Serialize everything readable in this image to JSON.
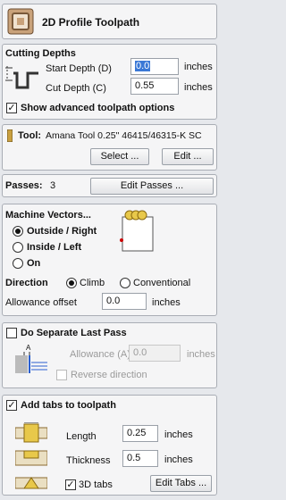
{
  "header": {
    "title": "2D Profile Toolpath",
    "icon": "profile-toolpath-icon"
  },
  "cutting_depths": {
    "title": "Cutting Depths",
    "start_label": "Start Depth (D)",
    "start_value": "0.0",
    "start_unit": "inches",
    "cut_label": "Cut Depth (C)",
    "cut_value": "0.55",
    "cut_unit": "inches",
    "advanced_label": "Show advanced toolpath options",
    "advanced_checked": true
  },
  "tool": {
    "label": "Tool:",
    "name": "Amana Tool 0.25\" 46415/46315-K SC",
    "select_label": "Select ...",
    "edit_label": "Edit ..."
  },
  "passes": {
    "label": "Passes:",
    "value": "3",
    "edit_label": "Edit Passes ..."
  },
  "machine_vectors": {
    "title": "Machine Vectors...",
    "options": [
      "Outside / Right",
      "Inside / Left",
      "On"
    ],
    "selected": "Outside / Right",
    "direction_label": "Direction",
    "direction_options": [
      "Climb",
      "Conventional"
    ],
    "direction_selected": "Climb",
    "allowance_label": "Allowance offset",
    "allowance_value": "0.0",
    "allowance_unit": "inches"
  },
  "separate_last_pass": {
    "title": "Do Separate Last Pass",
    "checked": false,
    "allowance_label": "Allowance (A)",
    "allowance_value": "0.0",
    "allowance_unit": "inches",
    "reverse_label": "Reverse direction",
    "diagram_letter": "A"
  },
  "tabs": {
    "title": "Add tabs to toolpath",
    "checked": true,
    "length_label": "Length",
    "length_value": "0.25",
    "length_unit": "inches",
    "thickness_label": "Thickness",
    "thickness_value": "0.5",
    "thickness_unit": "inches",
    "tabs3d_label": "3D tabs",
    "tabs3d_checked": true,
    "edit_label": "Edit Tabs ..."
  },
  "colors": {
    "panel": "#f5f5f6",
    "background": "#e6e8ec",
    "selection": "#3a78d6",
    "tab_yellow": "#e8c84a"
  }
}
